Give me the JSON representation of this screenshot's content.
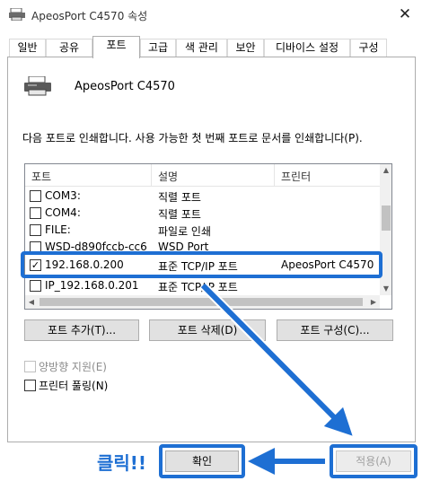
{
  "window": {
    "title": "ApeosPort C4570 속성",
    "close_glyph": "✕"
  },
  "tabs": [
    {
      "label": "일반"
    },
    {
      "label": "공유"
    },
    {
      "label": "포트",
      "active": true
    },
    {
      "label": "고급"
    },
    {
      "label": "색 관리"
    },
    {
      "label": "보안"
    },
    {
      "label": "디바이스 설정"
    },
    {
      "label": "구성"
    }
  ],
  "printer": {
    "name": "ApeosPort C4570",
    "icon": "printer-icon"
  },
  "description": "다음 포트로 인쇄합니다. 사용 가능한 첫 번째 포트로 문서를 인쇄합니다(P).",
  "port_list": {
    "headers": [
      "포트",
      "설명",
      "프린터"
    ],
    "rows": [
      {
        "port": "COM3:",
        "desc": "직렬 포트",
        "printer": "",
        "checked": false
      },
      {
        "port": "COM4:",
        "desc": "직렬 포트",
        "printer": "",
        "checked": false
      },
      {
        "port": "FILE:",
        "desc": "파일로 인쇄",
        "printer": "",
        "checked": false
      },
      {
        "port": "WSD-d890fccb-cc6",
        "desc": "WSD Port",
        "printer": "",
        "checked": false
      },
      {
        "port": "192.168.0.200",
        "desc": "표준 TCP/IP 포트",
        "printer": "ApeosPort C4570",
        "checked": true
      },
      {
        "port": "IP_192.168.0.201",
        "desc": "표준 TCP/IP 포트",
        "printer": "",
        "checked": false
      }
    ]
  },
  "buttons": {
    "add_port": "포트 추가(T)...",
    "delete_port": "포트 삭제(D)",
    "configure_port": "포트 구성(C)...",
    "ok": "확인",
    "apply": "적용(A)"
  },
  "options": {
    "bidirectional": "양방향 지원(E)",
    "pooling": "프린터 풀링(N)"
  },
  "annotation": {
    "label": "클릭!!",
    "color": "#1e6fd3"
  }
}
